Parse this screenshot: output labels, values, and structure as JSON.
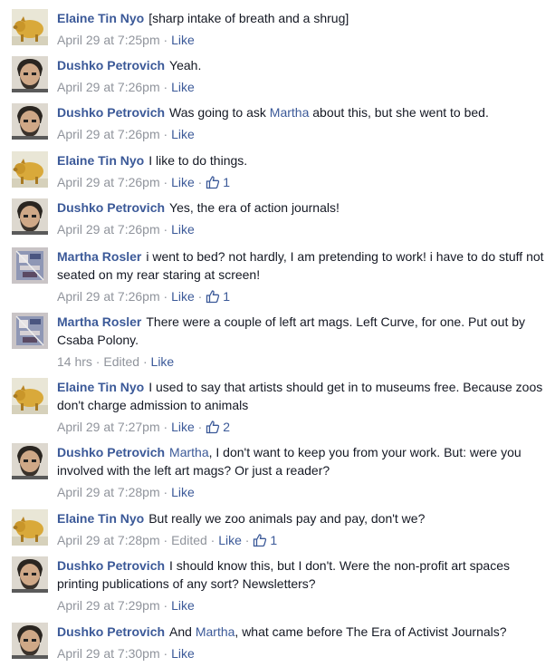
{
  "colors": {
    "link": "#3b5998",
    "meta": "#90949c",
    "text": "#141823"
  },
  "comments": [
    {
      "author": "Elaine Tin Nyo",
      "avatar": "pig",
      "parts": [
        {
          "t": "[sharp intake of breath and a shrug]"
        }
      ],
      "time": "April 29 at 7:25pm",
      "edited": "",
      "like": "Like",
      "likes": ""
    },
    {
      "author": "Dushko Petrovich",
      "avatar": "man",
      "parts": [
        {
          "t": "Yeah."
        }
      ],
      "time": "April 29 at 7:26pm",
      "edited": "",
      "like": "Like",
      "likes": ""
    },
    {
      "author": "Dushko Petrovich",
      "avatar": "man",
      "parts": [
        {
          "t": "Was going to ask "
        },
        {
          "t": "Martha",
          "m": true
        },
        {
          "t": " about this, but she went to bed."
        }
      ],
      "time": "April 29 at 7:26pm",
      "edited": "",
      "like": "Like",
      "likes": ""
    },
    {
      "author": "Elaine Tin Nyo",
      "avatar": "pig",
      "parts": [
        {
          "t": "I like to do things."
        }
      ],
      "time": "April 29 at 7:26pm",
      "edited": "",
      "like": "Like",
      "likes": "1"
    },
    {
      "author": "Dushko Petrovich",
      "avatar": "man",
      "parts": [
        {
          "t": "Yes, the era of action journals!"
        }
      ],
      "time": "April 29 at 7:26pm",
      "edited": "",
      "like": "Like",
      "likes": ""
    },
    {
      "author": "Martha Rosler",
      "avatar": "art",
      "parts": [
        {
          "t": "i went to bed? not hardly, I am pretending to work! i have to do stuff not seated on my rear staring at screen!"
        }
      ],
      "time": "April 29 at 7:26pm",
      "edited": "",
      "like": "Like",
      "likes": "1"
    },
    {
      "author": "Martha Rosler",
      "avatar": "art",
      "parts": [
        {
          "t": "There were a couple of left art mags. Left Curve, for one. Put out by Csaba Polony."
        }
      ],
      "time": "14 hrs",
      "edited": "Edited",
      "like": "Like",
      "likes": ""
    },
    {
      "author": "Elaine Tin Nyo",
      "avatar": "pig",
      "parts": [
        {
          "t": "I used to say that artists should get in to museums free. Because zoos don't charge admission to animals"
        }
      ],
      "time": "April 29 at 7:27pm",
      "edited": "",
      "like": "Like",
      "likes": "2"
    },
    {
      "author": "Dushko Petrovich",
      "avatar": "man",
      "parts": [
        {
          "t": "Martha",
          "m": true
        },
        {
          "t": ", I don't want to keep you from your work. But: were you involved with the left art mags? Or just a reader?"
        }
      ],
      "time": "April 29 at 7:28pm",
      "edited": "",
      "like": "Like",
      "likes": ""
    },
    {
      "author": "Elaine Tin Nyo",
      "avatar": "pig",
      "parts": [
        {
          "t": "But really we zoo animals pay and pay, don't we?"
        }
      ],
      "time": "April 29 at 7:28pm",
      "edited": "Edited",
      "like": "Like",
      "likes": "1"
    },
    {
      "author": "Dushko Petrovich",
      "avatar": "man",
      "parts": [
        {
          "t": "I should know this, but I don't. Were the non-profit art spaces printing publications of any sort? Newsletters?"
        }
      ],
      "time": "April 29 at 7:29pm",
      "edited": "",
      "like": "Like",
      "likes": ""
    },
    {
      "author": "Dushko Petrovich",
      "avatar": "man",
      "parts": [
        {
          "t": "And "
        },
        {
          "t": "Martha",
          "m": true
        },
        {
          "t": ", what came before The Era of Activist Journals?"
        }
      ],
      "time": "April 29 at 7:30pm",
      "edited": "",
      "like": "Like",
      "likes": ""
    }
  ]
}
